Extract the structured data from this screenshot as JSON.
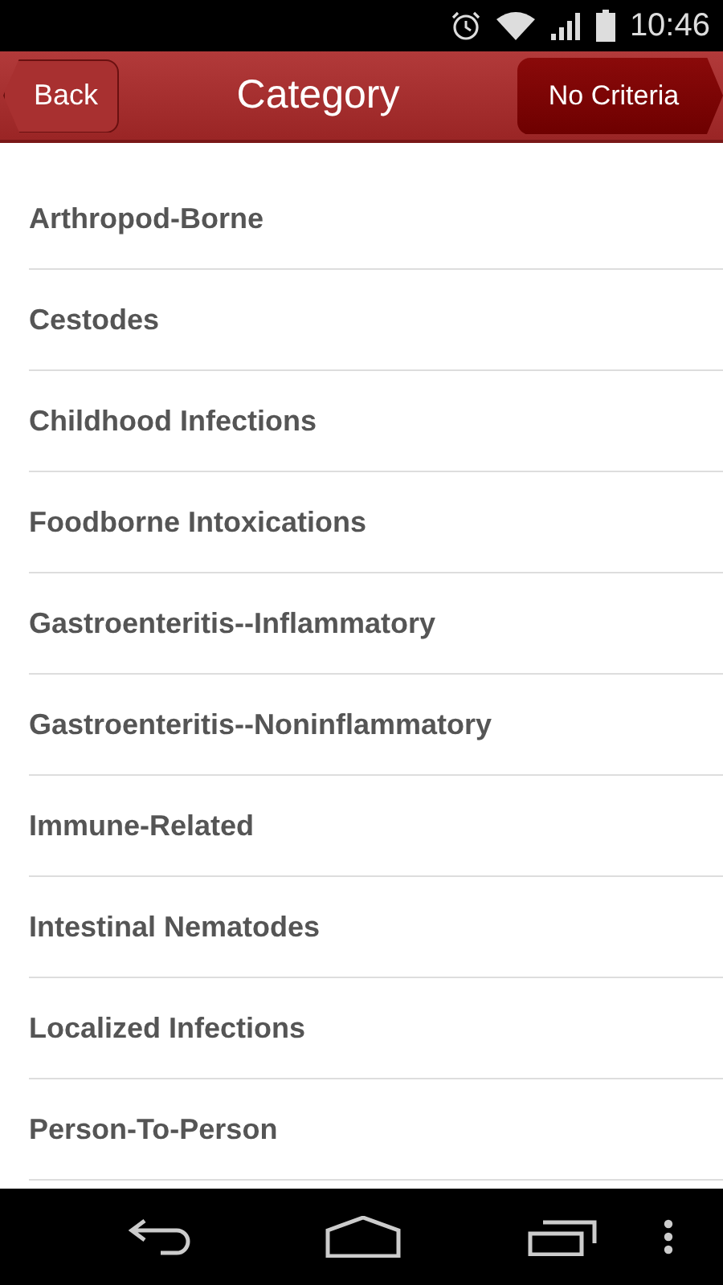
{
  "status_bar": {
    "time": "10:46"
  },
  "header": {
    "back_button": "Back",
    "title": "Category",
    "criteria_button": "No Criteria"
  },
  "items": [
    {
      "label": "Arthropod-Borne"
    },
    {
      "label": "Cestodes"
    },
    {
      "label": "Childhood Infections"
    },
    {
      "label": "Foodborne Intoxications"
    },
    {
      "label": "Gastroenteritis--Inflammatory"
    },
    {
      "label": "Gastroenteritis--Noninflammatory"
    },
    {
      "label": "Immune-Related"
    },
    {
      "label": "Intestinal Nematodes"
    },
    {
      "label": "Localized Infections"
    },
    {
      "label": "Person-To-Person"
    }
  ]
}
